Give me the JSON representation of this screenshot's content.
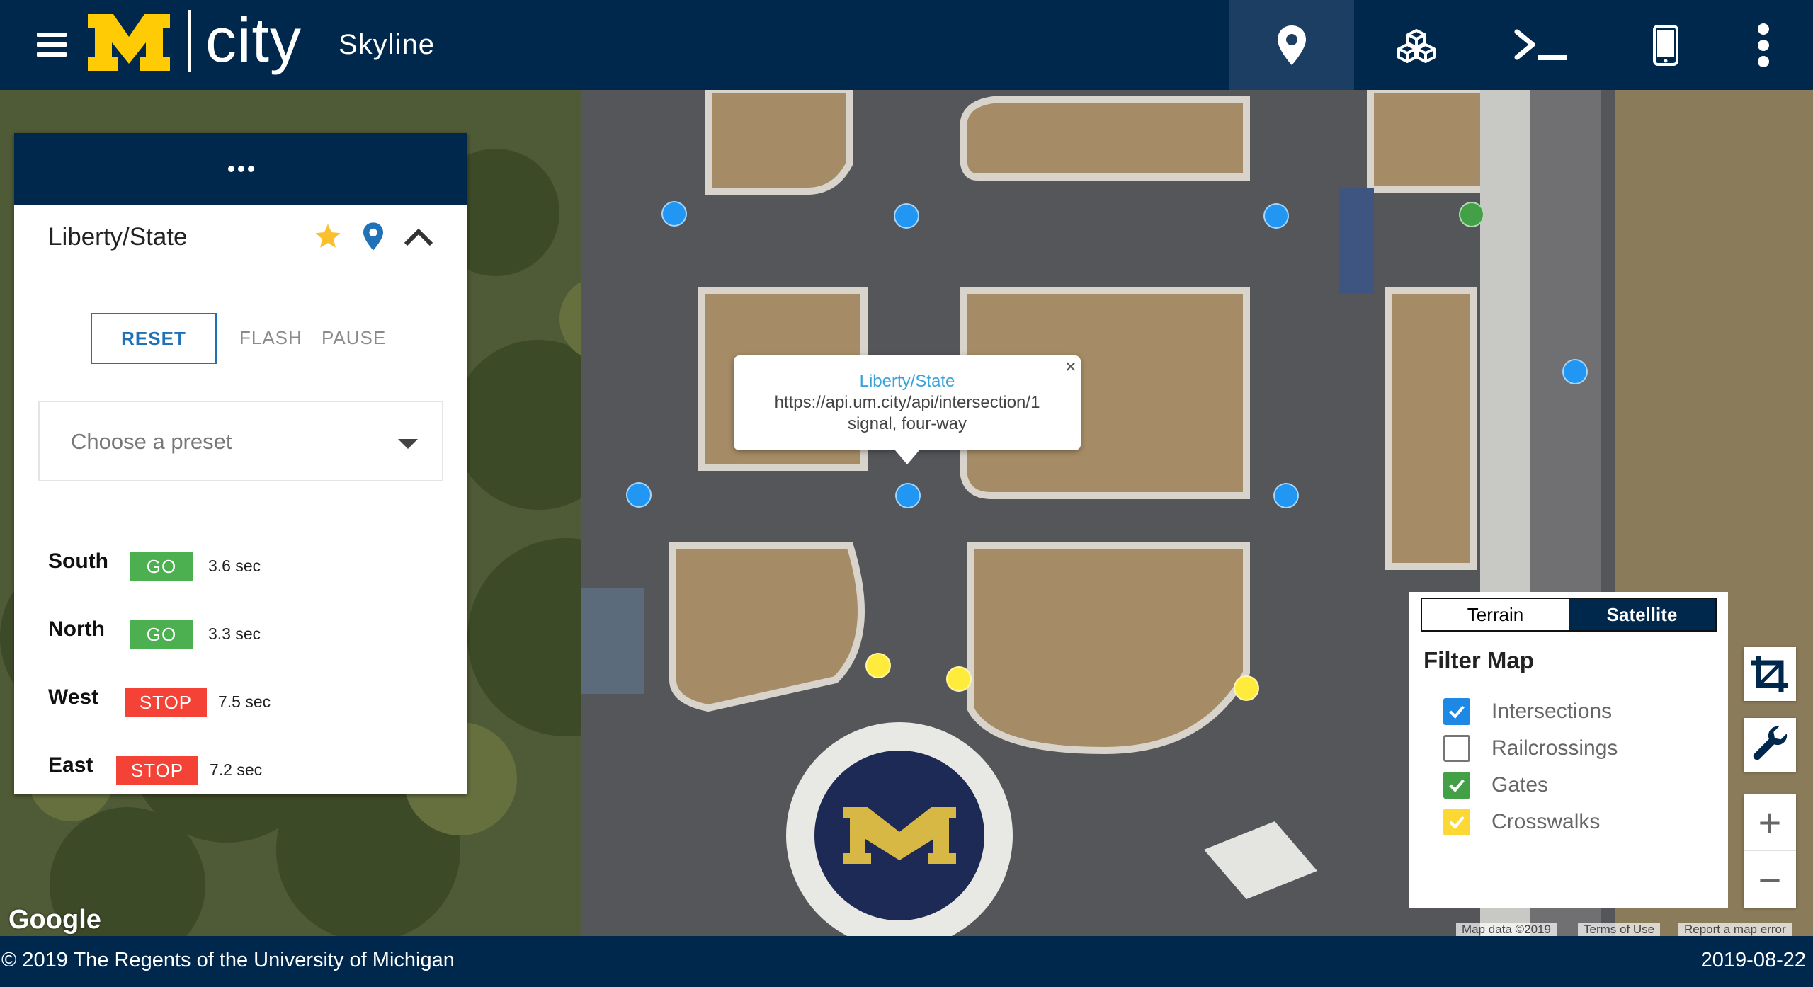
{
  "header": {
    "brand_letter": "M",
    "brand_city": "city",
    "app_name": "Skyline",
    "nav": [
      {
        "name": "map-marker-icon",
        "active": true
      },
      {
        "name": "cubes-icon",
        "active": false
      },
      {
        "name": "terminal-icon",
        "active": false
      },
      {
        "name": "mobile-icon",
        "active": false
      },
      {
        "name": "more-vert-icon",
        "active": false
      }
    ]
  },
  "intersection_panel": {
    "title": "Liberty/State",
    "buttons": {
      "reset": "RESET",
      "flash": "FLASH",
      "pause": "PAUSE"
    },
    "preset": {
      "placeholder": "Choose a preset"
    },
    "signals": [
      {
        "direction": "South",
        "status": "GO",
        "time": "3.6 sec"
      },
      {
        "direction": "North",
        "status": "GO",
        "time": "3.3 sec"
      },
      {
        "direction": "West",
        "status": "STOP",
        "time": "7.5 sec"
      },
      {
        "direction": "East",
        "status": "STOP",
        "time": "7.2 sec"
      }
    ]
  },
  "popup": {
    "title": "Liberty/State",
    "url": "https://api.um.city/api/intersection/1",
    "type": "signal, four-way",
    "close": "×"
  },
  "map_type": {
    "terrain": "Terrain",
    "satellite": "Satellite",
    "selected": "Satellite"
  },
  "filter": {
    "title": "Filter Map",
    "items": [
      {
        "label": "Intersections",
        "checked": true,
        "color": "#1e88e5"
      },
      {
        "label": "Railcrossings",
        "checked": false,
        "color": "#757575"
      },
      {
        "label": "Gates",
        "checked": true,
        "color": "#43a047"
      },
      {
        "label": "Crosswalks",
        "checked": true,
        "color": "#fdd835"
      }
    ]
  },
  "map_controls": {
    "zoom_in": "+",
    "zoom_out": "−"
  },
  "map_attribution": {
    "google": "Google",
    "map_data": "Map data ©2019",
    "terms": "Terms of Use",
    "report": "Report a map error"
  },
  "footer": {
    "copyright": "© 2019 The Regents of the University of Michigan",
    "date": "2019-08-22"
  },
  "colors": {
    "navy": "#00274c",
    "maize": "#ffcb05",
    "go": "#4caf50",
    "stop": "#f44336",
    "link": "#1f71b8",
    "intersection_marker": "#2196f3",
    "gate_marker": "#43a047",
    "crosswalk_marker": "#ffeb3b"
  }
}
